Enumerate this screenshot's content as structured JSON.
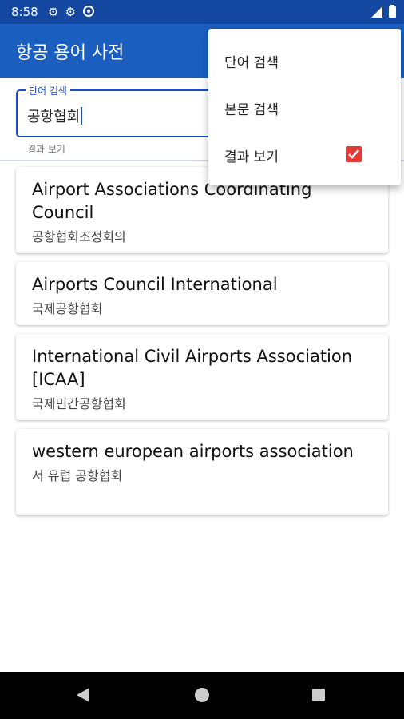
{
  "status_bar": {
    "time": "8:58"
  },
  "app_bar": {
    "title": "항공 용어 사전"
  },
  "search": {
    "label": "단어 검색",
    "value": "공항협회",
    "helper": "결과 보기"
  },
  "results": [
    {
      "title": "Airport Associations Coordinating Council",
      "subtitle": "공항협회조정회의"
    },
    {
      "title": "Airports Council International",
      "subtitle": "국제공항협회"
    },
    {
      "title": "International Civil Airports Association [ICAA]",
      "subtitle": "국제민간공항협회"
    },
    {
      "title": "western european airports association",
      "subtitle": "서 유럽 공항협회"
    }
  ],
  "menu": {
    "items": [
      "단어 검색",
      "본문 검색",
      "결과 보기"
    ],
    "show_results_checked": true
  },
  "colors": {
    "app_bar": "#1a5fbf",
    "status_bar": "#1448a0",
    "accent": "#1a4ec8",
    "checkbox": "#e53935"
  }
}
